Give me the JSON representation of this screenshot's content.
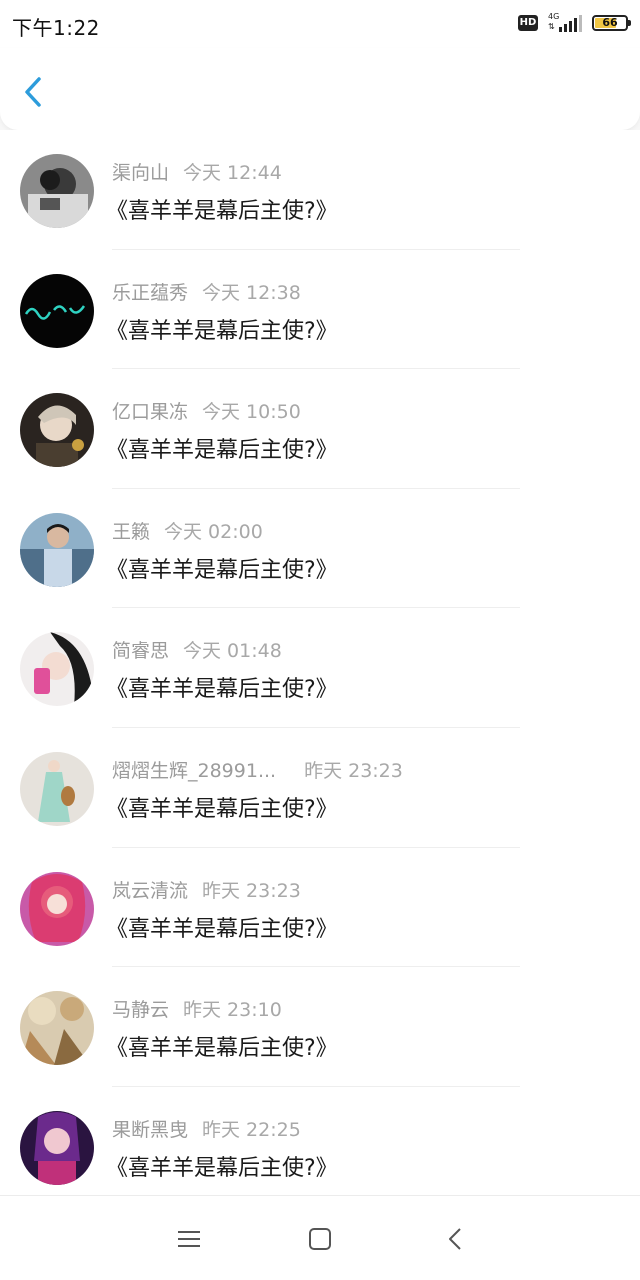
{
  "status_bar": {
    "time": "下午1:22",
    "hd": "HD",
    "network": "4G",
    "battery_level": "66",
    "battery_fill": 0.66
  },
  "header": {
    "back_icon": "chevron-left-icon"
  },
  "list": [
    {
      "name": "渠向山",
      "time": "今天 12:44",
      "message": "《喜羊羊是幕后主使?》"
    },
    {
      "name": "乐正蕴秀",
      "time": "今天 12:38",
      "message": "《喜羊羊是幕后主使?》"
    },
    {
      "name": "亿口果冻",
      "time": "今天 10:50",
      "message": "《喜羊羊是幕后主使?》"
    },
    {
      "name": "王籁",
      "time": "今天 02:00",
      "message": "《喜羊羊是幕后主使?》"
    },
    {
      "name": "简睿思",
      "time": "今天 01:48",
      "message": "《喜羊羊是幕后主使?》"
    },
    {
      "name": "熠熠生辉_28991...",
      "time": "昨天 23:23",
      "message": "《喜羊羊是幕后主使?》"
    },
    {
      "name": "岚云清流",
      "time": "昨天 23:23",
      "message": "《喜羊羊是幕后主使?》"
    },
    {
      "name": "马静云",
      "time": "昨天 23:10",
      "message": "《喜羊羊是幕后主使?》"
    },
    {
      "name": "果断黑曳",
      "time": "昨天 22:25",
      "message": "《喜羊羊是幕后主使?》"
    }
  ],
  "nav": {
    "menu_icon": "menu-icon",
    "home_icon": "square-home-icon",
    "back_icon": "triangle-back-icon"
  },
  "colors": {
    "accent": "#2d9cdb",
    "name_text": "#9b9b9b",
    "message_text": "#1a1a1a"
  }
}
